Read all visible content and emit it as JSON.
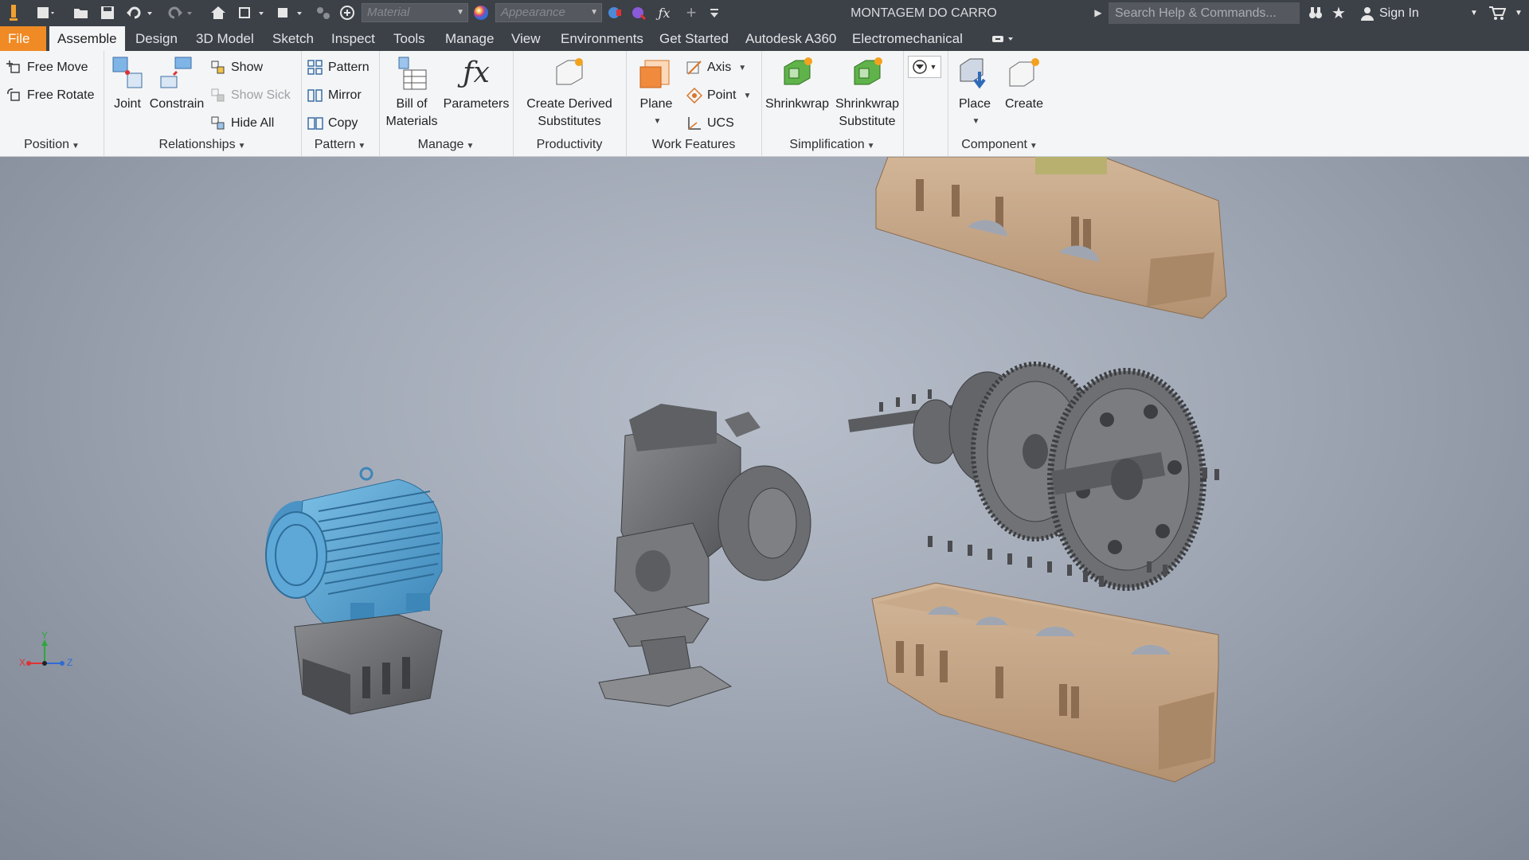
{
  "titlebar": {
    "material_placeholder": "Material",
    "appearance_placeholder": "Appearance",
    "document_title": "MONTAGEM DO CARRO",
    "search_placeholder": "Search Help & Commands...",
    "sign_in": "Sign In"
  },
  "tabs": [
    {
      "label": "File"
    },
    {
      "label": "Assemble"
    },
    {
      "label": "Design"
    },
    {
      "label": "3D Model"
    },
    {
      "label": "Sketch"
    },
    {
      "label": "Inspect"
    },
    {
      "label": "Tools"
    },
    {
      "label": "Manage"
    },
    {
      "label": "View"
    },
    {
      "label": "Environments"
    },
    {
      "label": "Get Started"
    },
    {
      "label": "Autodesk A360"
    },
    {
      "label": "Electromechanical"
    }
  ],
  "ribbon": {
    "position": {
      "title": "Position",
      "free_move": "Free Move",
      "free_rotate": "Free Rotate"
    },
    "relationships": {
      "title": "Relationships",
      "joint": "Joint",
      "constrain": "Constrain",
      "show": "Show",
      "show_sick": "Show Sick",
      "hide_all": "Hide All"
    },
    "pattern": {
      "title": "Pattern",
      "pattern": "Pattern",
      "mirror": "Mirror",
      "copy": "Copy"
    },
    "manage": {
      "title": "Manage",
      "bom_line1": "Bill of",
      "bom_line2": "Materials",
      "parameters": "Parameters"
    },
    "productivity": {
      "title": "Productivity",
      "line1": "Create Derived",
      "line2": "Substitutes"
    },
    "work_features": {
      "title": "Work Features",
      "plane": "Plane",
      "axis": "Axis",
      "point": "Point",
      "ucs": "UCS"
    },
    "simplification": {
      "title": "Simplification",
      "shrinkwrap": "Shrinkwrap",
      "sub_line1": "Shrinkwrap",
      "sub_line2": "Substitute"
    },
    "component": {
      "title": "Component",
      "place": "Place",
      "create": "Create"
    }
  },
  "viewcube_axes": {
    "x": "X",
    "y": "Y",
    "z": "Z"
  },
  "colors": {
    "file_tab": "#f08a24",
    "motor": "#5aa6d2",
    "housing": "#c7a98a",
    "steel": "#6d6f72"
  }
}
